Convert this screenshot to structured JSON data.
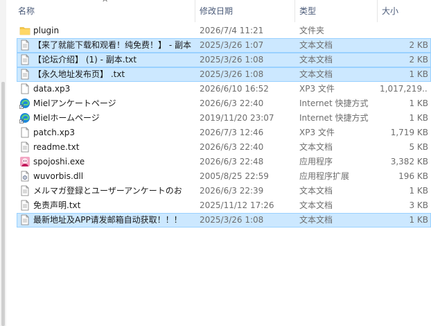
{
  "columns": {
    "name": "名称",
    "date": "修改日期",
    "type": "类型",
    "size": "大小"
  },
  "files": [
    {
      "name": "plugin",
      "date": "2026/7/4 11:21",
      "type": "文件夹",
      "size": "",
      "icon": "folder-icon",
      "selected": false
    },
    {
      "name": "【来了就能下载和观看！纯免费！】 - 副本",
      "date": "2025/3/26 1:07",
      "type": "文本文档",
      "size": "2 KB",
      "icon": "text-file-icon",
      "selected": true
    },
    {
      "name": "【论坛介绍】 (1) - 副本.txt",
      "date": "2025/3/26 1:08",
      "type": "文本文档",
      "size": "2 KB",
      "icon": "text-file-icon",
      "selected": true
    },
    {
      "name": "【永久地址发布页】 .txt",
      "date": "2025/3/26 1:08",
      "type": "文本文档",
      "size": "1 KB",
      "icon": "text-file-icon",
      "selected": true
    },
    {
      "name": "data.xp3",
      "date": "2026/6/10 16:52",
      "type": "XP3 文件",
      "size": "1,017,219...",
      "icon": "generic-file-icon",
      "selected": false
    },
    {
      "name": "Mielアンケートページ",
      "date": "2026/6/3 22:40",
      "type": "Internet 快捷方式",
      "size": "1 KB",
      "icon": "edge-shortcut-icon",
      "selected": false
    },
    {
      "name": "Mielホームページ",
      "date": "2019/11/20 23:07",
      "type": "Internet 快捷方式",
      "size": "1 KB",
      "icon": "edge-shortcut-icon",
      "selected": false
    },
    {
      "name": "patch.xp3",
      "date": "2026/7/3 12:46",
      "type": "XP3 文件",
      "size": "1,719 KB",
      "icon": "generic-file-icon",
      "selected": false
    },
    {
      "name": "readme.txt",
      "date": "2026/6/3 22:40",
      "type": "文本文档",
      "size": "5 KB",
      "icon": "text-file-icon",
      "selected": false
    },
    {
      "name": "spojoshi.exe",
      "date": "2026/6/3 22:48",
      "type": "应用程序",
      "size": "3,382 KB",
      "icon": "app-exe-icon",
      "selected": false
    },
    {
      "name": "wuvorbis.dll",
      "date": "2005/8/25 22:59",
      "type": "应用程序扩展",
      "size": "196 KB",
      "icon": "dll-file-icon",
      "selected": false
    },
    {
      "name": "メルマガ登録とユーザーアンケートのお",
      "date": "2026/6/3 22:39",
      "type": "文本文档",
      "size": "1 KB",
      "icon": "text-file-icon",
      "selected": false
    },
    {
      "name": "免责声明.txt",
      "date": "2025/11/12 17:26",
      "type": "文本文档",
      "size": "3 KB",
      "icon": "text-file-icon",
      "selected": false
    },
    {
      "name": "最新地址及APP请发邮箱自动获取！！！",
      "date": "2025/3/26 1:08",
      "type": "文本文档",
      "size": "1 KB",
      "icon": "text-file-icon",
      "selected": true
    }
  ],
  "colors": {
    "selection_bg": "#cce8ff",
    "selection_border": "#99d1ff",
    "header_text": "#4a5a78"
  }
}
